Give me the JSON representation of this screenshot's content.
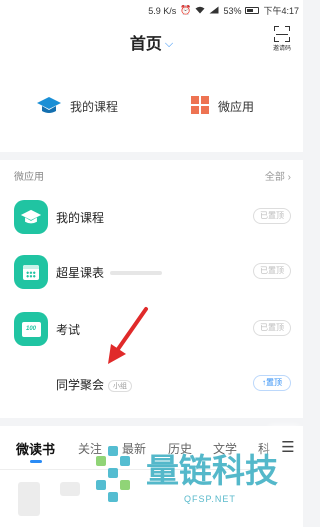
{
  "status_bar": {
    "net_speed": "5.9 K/s",
    "signal": "⁴⁶",
    "battery": "53%",
    "time": "下午4:17"
  },
  "header": {
    "title": "首页",
    "scan_label": "邀请码"
  },
  "quick_actions": [
    {
      "label": "我的课程",
      "icon": "graduation-cap-icon"
    },
    {
      "label": "微应用",
      "icon": "grid-icon"
    }
  ],
  "apps": {
    "section_title": "微应用",
    "all_label": "全部 ›",
    "items": [
      {
        "name": "我的课程",
        "icon": "graduation-cap-icon",
        "pin": "已置顶",
        "tag": ""
      },
      {
        "name": "超星课表",
        "icon": "calendar-icon",
        "pin": "已置顶",
        "tag": ""
      },
      {
        "name": "考试",
        "icon": "exam-icon",
        "icon_text": "100",
        "pin": "已置顶",
        "tag": ""
      },
      {
        "name": "同学聚会",
        "icon": "",
        "pin": "↑置顶",
        "tag": "小组"
      }
    ]
  },
  "tabs": {
    "items": [
      "微读书",
      "关注",
      "最新",
      "历史",
      "文学",
      "科"
    ],
    "active": "微读书",
    "menu_icon": "☰"
  },
  "watermark": {
    "text": "量链科技",
    "url": "QFSP.NET"
  },
  "colors": {
    "accent": "#2a8bf5",
    "app_teal": "#20c4a2",
    "grid_orange": "#ee7352",
    "arrow_red": "#e02a2a",
    "watermark": "#2ea8be"
  }
}
